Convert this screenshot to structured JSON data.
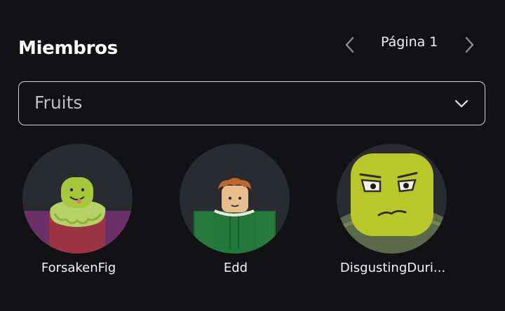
{
  "section": {
    "title": "Miembros"
  },
  "pagination": {
    "label": "Página 1",
    "prev_icon": "chevron-left-icon",
    "next_icon": "chevron-right-icon"
  },
  "role_select": {
    "selected": "Fruits",
    "icon": "chevron-down-icon"
  },
  "members": [
    {
      "name": "ForsakenFig"
    },
    {
      "name": "Edd"
    },
    {
      "name": "DisgustingDuri..."
    }
  ],
  "colors": {
    "background": "#121215",
    "avatar_bg": "#2a2b30",
    "border": "#cfd0d3",
    "text": "#ffffff",
    "muted_text": "#bdbec2"
  }
}
